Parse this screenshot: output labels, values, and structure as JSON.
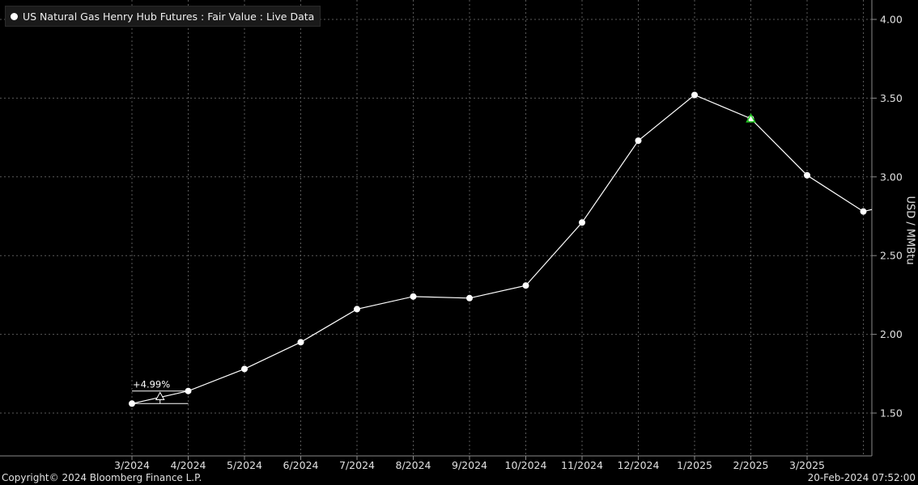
{
  "legend": {
    "label": "US Natural Gas Henry Hub Futures : Fair Value : Live Data"
  },
  "footer": {
    "copyright": "Copyright© 2024 Bloomberg Finance L.P.",
    "timestamp": "20-Feb-2024 07:52:00"
  },
  "colors": {
    "background": "#000000",
    "line": "#ffffff",
    "grid": "#5a5a5a",
    "marker": "#22cc22"
  },
  "chart_data": {
    "type": "line",
    "title": "US Natural Gas Henry Hub Futures : Fair Value : Live Data",
    "ylabel": "USD / MMBtu",
    "ylim": [
      1.25,
      4.1
    ],
    "y_ticks": [
      "1.50",
      "2.00",
      "2.50",
      "3.00",
      "3.50",
      "4.00"
    ],
    "y_tick_values": [
      1.5,
      2.0,
      2.5,
      3.0,
      3.5,
      4.0
    ],
    "x_tick_labels": [
      "3/2024",
      "4/2024",
      "5/2024",
      "6/2024",
      "7/2024",
      "8/2024",
      "9/2024",
      "10/2024",
      "11/2024",
      "12/2024",
      "1/2025",
      "2/2025",
      "3/2025"
    ],
    "grid": true,
    "series": [
      {
        "name": "US Natural Gas Henry Hub Futures : Fair Value : Live Data",
        "x": [
          "3/2024",
          "4/2024",
          "5/2024",
          "6/2024",
          "7/2024",
          "8/2024",
          "9/2024",
          "10/2024",
          "11/2024",
          "12/2024",
          "1/2025",
          "2/2025",
          "3/2025",
          "4/2025"
        ],
        "values": [
          1.56,
          1.64,
          1.78,
          1.95,
          2.16,
          2.24,
          2.23,
          2.31,
          2.71,
          3.23,
          3.52,
          3.37,
          3.01,
          2.78
        ]
      }
    ],
    "highlight": {
      "x": "2/2025",
      "value": 3.37,
      "marker": "green-triangle"
    },
    "annotation": {
      "text": "+4.99%",
      "from": "3/2024",
      "to": "4/2024"
    }
  }
}
